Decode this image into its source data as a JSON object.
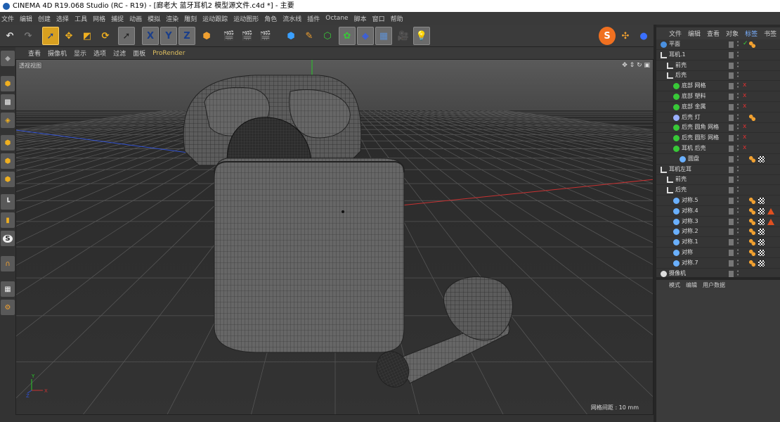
{
  "window": {
    "title": "CINEMA 4D R19.068 Studio (RC - R19) - [廊老大 蓝牙耳机2 模型源文件.c4d *] - 主要"
  },
  "menu": [
    "文件",
    "编辑",
    "创建",
    "选择",
    "工具",
    "网格",
    "捕捉",
    "动画",
    "模拟",
    "渲染",
    "雕刻",
    "运动跟踪",
    "运动图形",
    "角色",
    "流水线",
    "插件",
    "Octane",
    "脚本",
    "窗口",
    "帮助"
  ],
  "toolbar": {
    "axis_x": "X",
    "axis_y": "Y",
    "axis_z": "Z"
  },
  "viewport": {
    "menu": [
      "查看",
      "摄像机",
      "显示",
      "选项",
      "过滤",
      "面板"
    ],
    "prorender": "ProRender",
    "label": "透视视图",
    "grid_info": "网格间距 : 10 mm"
  },
  "object_manager": {
    "tabs": [
      "文件",
      "编辑",
      "查看",
      "对象",
      "标签",
      "书签"
    ],
    "selected_tab": "标签",
    "rows": [
      {
        "name": "平面",
        "icon": "plane-icon",
        "indent": 0,
        "check": "✓",
        "tags": [
          "orange-dots"
        ]
      },
      {
        "name": "耳机.1",
        "icon": "null-icon",
        "indent": 0,
        "tags": []
      },
      {
        "name": "前壳",
        "icon": "null-icon",
        "indent": 1,
        "tags": []
      },
      {
        "name": "后壳",
        "icon": "null-icon",
        "indent": 1,
        "tags": []
      },
      {
        "name": "底部 网格",
        "icon": "green-sphere-icon",
        "indent": 2,
        "flag": "x",
        "tags": []
      },
      {
        "name": "底部 塑料",
        "icon": "green-sphere-icon",
        "indent": 2,
        "flag": "x",
        "tags": []
      },
      {
        "name": "底部 金属",
        "icon": "green-sphere-icon",
        "indent": 2,
        "flag": "x",
        "tags": []
      },
      {
        "name": "后壳 灯",
        "icon": "light-icon",
        "indent": 2,
        "tags": [
          "orange-dots"
        ]
      },
      {
        "name": "后壳 圆角 网格",
        "icon": "green-sphere-icon",
        "indent": 2,
        "flag": "x",
        "tags": []
      },
      {
        "name": "后壳 圆形 网格",
        "icon": "green-sphere-icon",
        "indent": 2,
        "flag": "x",
        "tags": []
      },
      {
        "name": "耳机 后壳",
        "icon": "green-sphere-icon",
        "indent": 2,
        "flag": "x",
        "tags": []
      },
      {
        "name": "圆盘",
        "icon": "symmetry-icon",
        "indent": 3,
        "tags": [
          "orange-dots",
          "checker"
        ]
      },
      {
        "name": "耳机左耳",
        "icon": "null-icon",
        "indent": 0,
        "tags": []
      },
      {
        "name": "前壳",
        "icon": "null-icon",
        "indent": 1,
        "tags": []
      },
      {
        "name": "后壳",
        "icon": "null-icon",
        "indent": 1,
        "tags": []
      },
      {
        "name": "对称.5",
        "icon": "symmetry-icon",
        "indent": 2,
        "tags": [
          "orange-dots",
          "checker"
        ]
      },
      {
        "name": "对称.4",
        "icon": "symmetry-icon",
        "indent": 2,
        "tags": [
          "orange-dots",
          "checker",
          "warning"
        ]
      },
      {
        "name": "对称.3",
        "icon": "symmetry-icon",
        "indent": 2,
        "tags": [
          "orange-dots",
          "checker",
          "warning"
        ]
      },
      {
        "name": "对称.2",
        "icon": "symmetry-icon",
        "indent": 2,
        "tags": [
          "orange-dots",
          "checker"
        ]
      },
      {
        "name": "对称.1",
        "icon": "symmetry-icon",
        "indent": 2,
        "tags": [
          "orange-dots",
          "checker"
        ]
      },
      {
        "name": "对称",
        "icon": "symmetry-icon",
        "indent": 2,
        "tags": [
          "orange-dots",
          "checker"
        ]
      },
      {
        "name": "对称.7",
        "icon": "symmetry-icon",
        "indent": 2,
        "tags": [
          "orange-dots",
          "checker"
        ]
      },
      {
        "name": "摄像机",
        "icon": "camera-icon",
        "indent": 0,
        "tags": []
      }
    ]
  },
  "attribute_manager": {
    "tabs": [
      "模式",
      "编辑",
      "用户数据"
    ]
  },
  "colors": {
    "accent_blue": "#7ab0ff",
    "active_orange": "#d8a020",
    "red_axis": "#c83232",
    "green_axis": "#28c828",
    "blue_axis": "#2846d0"
  }
}
